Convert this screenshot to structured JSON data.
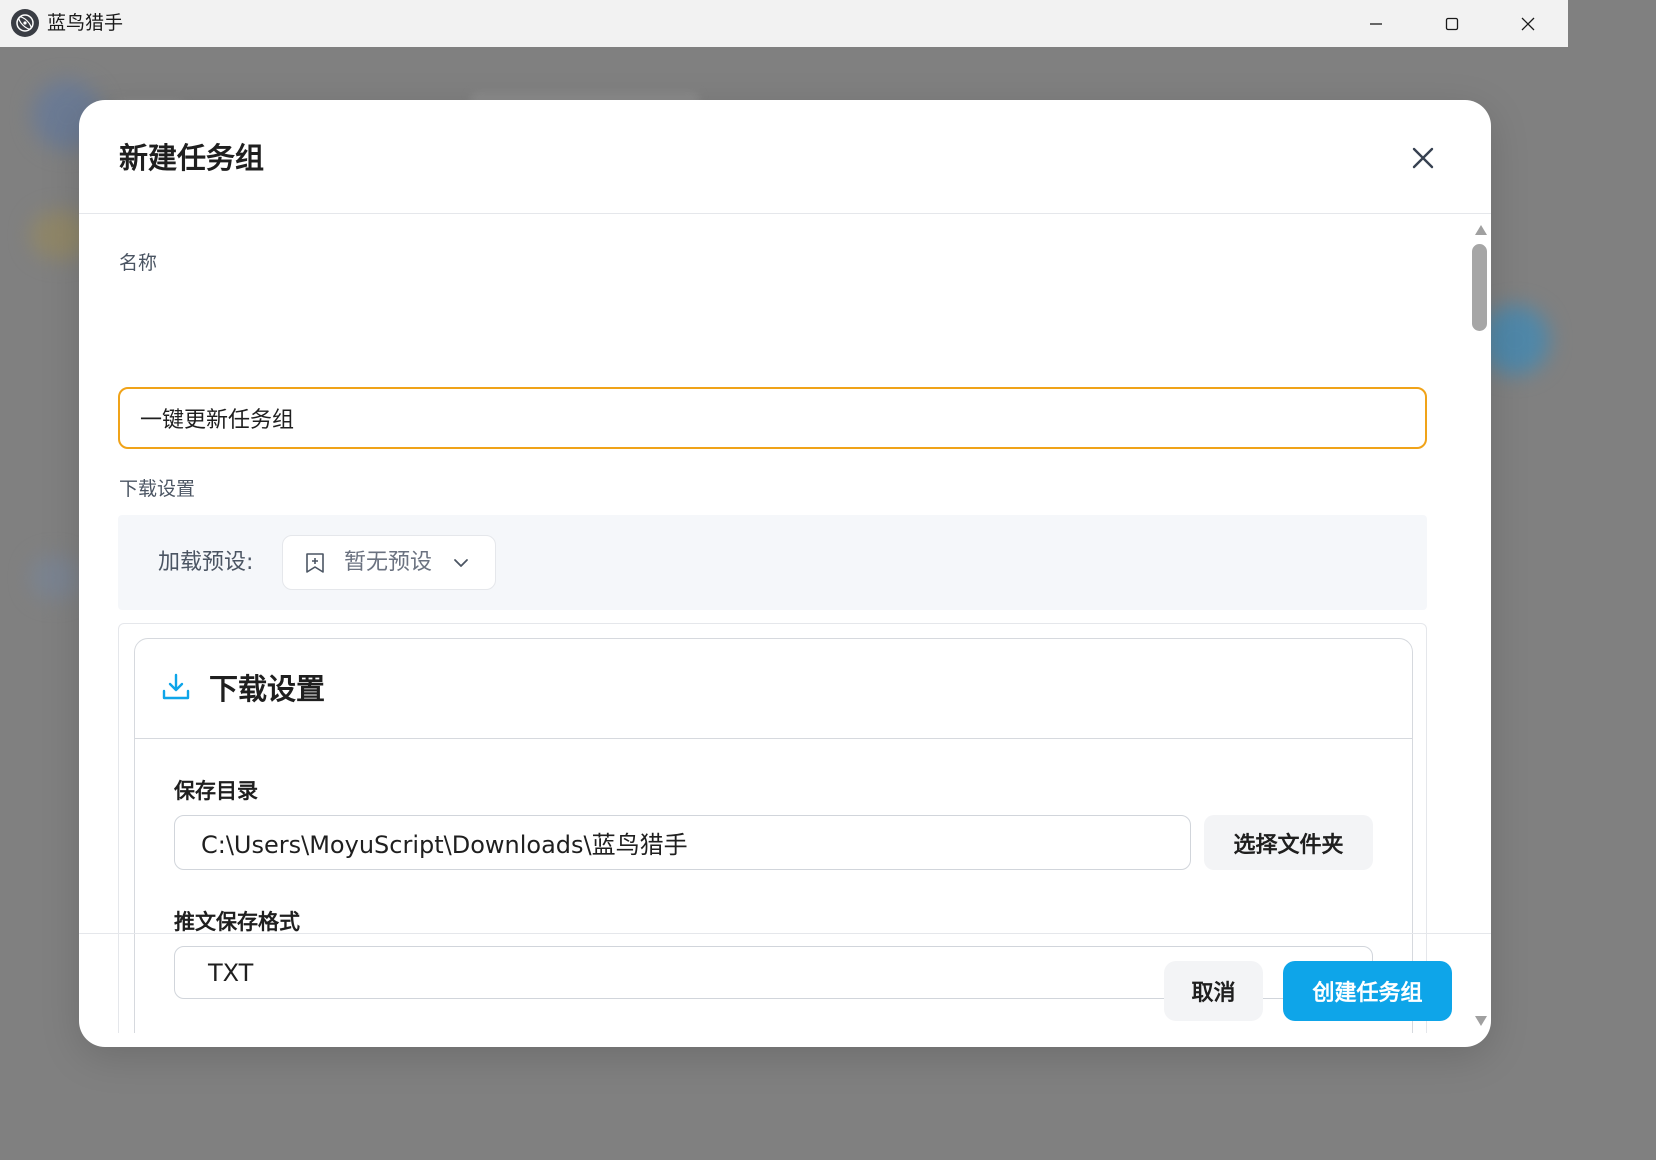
{
  "window": {
    "title": "蓝鸟猎手",
    "icon": "app-logo-icon",
    "controls": [
      "minimize-icon",
      "maximize-icon",
      "close-icon"
    ]
  },
  "modal": {
    "title": "新建任务组",
    "name_label": "名称",
    "name_value": "一键更新任务组",
    "download_settings_label": "下载设置",
    "preset": {
      "label": "加载预设:",
      "value": "暂无预设"
    },
    "section": {
      "title": "下载设置",
      "icon": "download-icon",
      "save_dir_label": "保存目录",
      "save_dir_value": "C:\\Users\\MoyuScript\\Downloads\\蓝鸟猎手",
      "pick_folder_label": "选择文件夹",
      "format_label": "推文保存格式",
      "format_value": "TXT"
    },
    "footer": {
      "cancel_label": "取消",
      "create_label": "创建任务组"
    }
  },
  "colors": {
    "accent": "#0ea5e9",
    "focus_border": "#f0a319",
    "overlay": "#808080"
  }
}
